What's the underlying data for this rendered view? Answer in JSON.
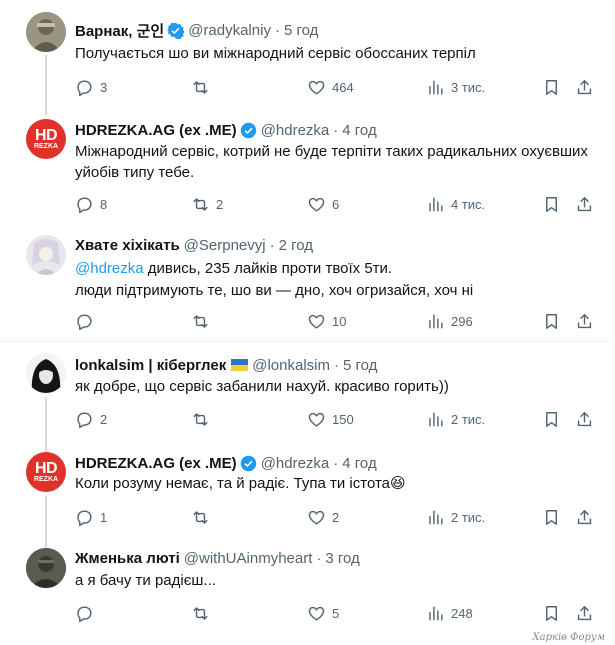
{
  "tweets": [
    {
      "name": "Варнак, 군인",
      "verified": true,
      "handle": "@radykalniy",
      "time": "5 год",
      "lines": [
        "Получається шо ви міжнародний сервіс обоссаних терпіл"
      ],
      "stats": {
        "replies": "3",
        "reposts": "",
        "likes": "464",
        "views": "3 тис."
      }
    },
    {
      "name": "HDREZKA.AG (ex .ME)",
      "verified": true,
      "handle": "@hdrezka",
      "time": "4 год",
      "lines": [
        "Міжнародний сервіс, котрий не буде терпіти таких радикальних охуєвших",
        "уйобів типу тебе."
      ],
      "stats": {
        "replies": "8",
        "reposts": "2",
        "likes": "6",
        "views": "4 тис."
      }
    },
    {
      "name": "Хвате хіхікать",
      "verified": false,
      "handle": "@Serpnevyj",
      "time": "2 год",
      "mention": "@hdrezka",
      "lines": [
        " дивись, 235 лайків проти твоїх 5ти.",
        "люди підтримують те, шо ви — дно, хоч огризайся, хоч ні"
      ],
      "stats": {
        "replies": "",
        "reposts": "",
        "likes": "10",
        "views": "296"
      }
    },
    {
      "name": "lonkalsim | кіберглек",
      "verified": false,
      "flag": "ukraine-flag-icon",
      "handle": "@lonkalsim",
      "time": "5 год",
      "lines": [
        "як добре, що сервіс забанили нахуй. красиво горить))"
      ],
      "stats": {
        "replies": "2",
        "reposts": "",
        "likes": "150",
        "views": "2 тис."
      }
    },
    {
      "name": "HDREZKA.AG (ex .ME)",
      "verified": true,
      "handle": "@hdrezka",
      "time": "4 год",
      "lines": [
        "Коли розуму немає, та й радіє. Тупа ти істота😆"
      ],
      "stats": {
        "replies": "1",
        "reposts": "",
        "likes": "2",
        "views": "2 тис."
      }
    },
    {
      "name": "Жменька люті",
      "verified": false,
      "handle": "@withUAinmyheart",
      "time": "3 год",
      "lines": [
        "а я бачу ти радієш..."
      ],
      "stats": {
        "replies": "",
        "reposts": "",
        "likes": "5",
        "views": "248"
      }
    }
  ],
  "hd_logo": {
    "big": "HD",
    "small": "REZKA"
  },
  "watermark": "Харків Форум",
  "colors": {
    "accent": "#1d9bf0",
    "hd_red": "#e0312b",
    "muted": "#536471"
  }
}
